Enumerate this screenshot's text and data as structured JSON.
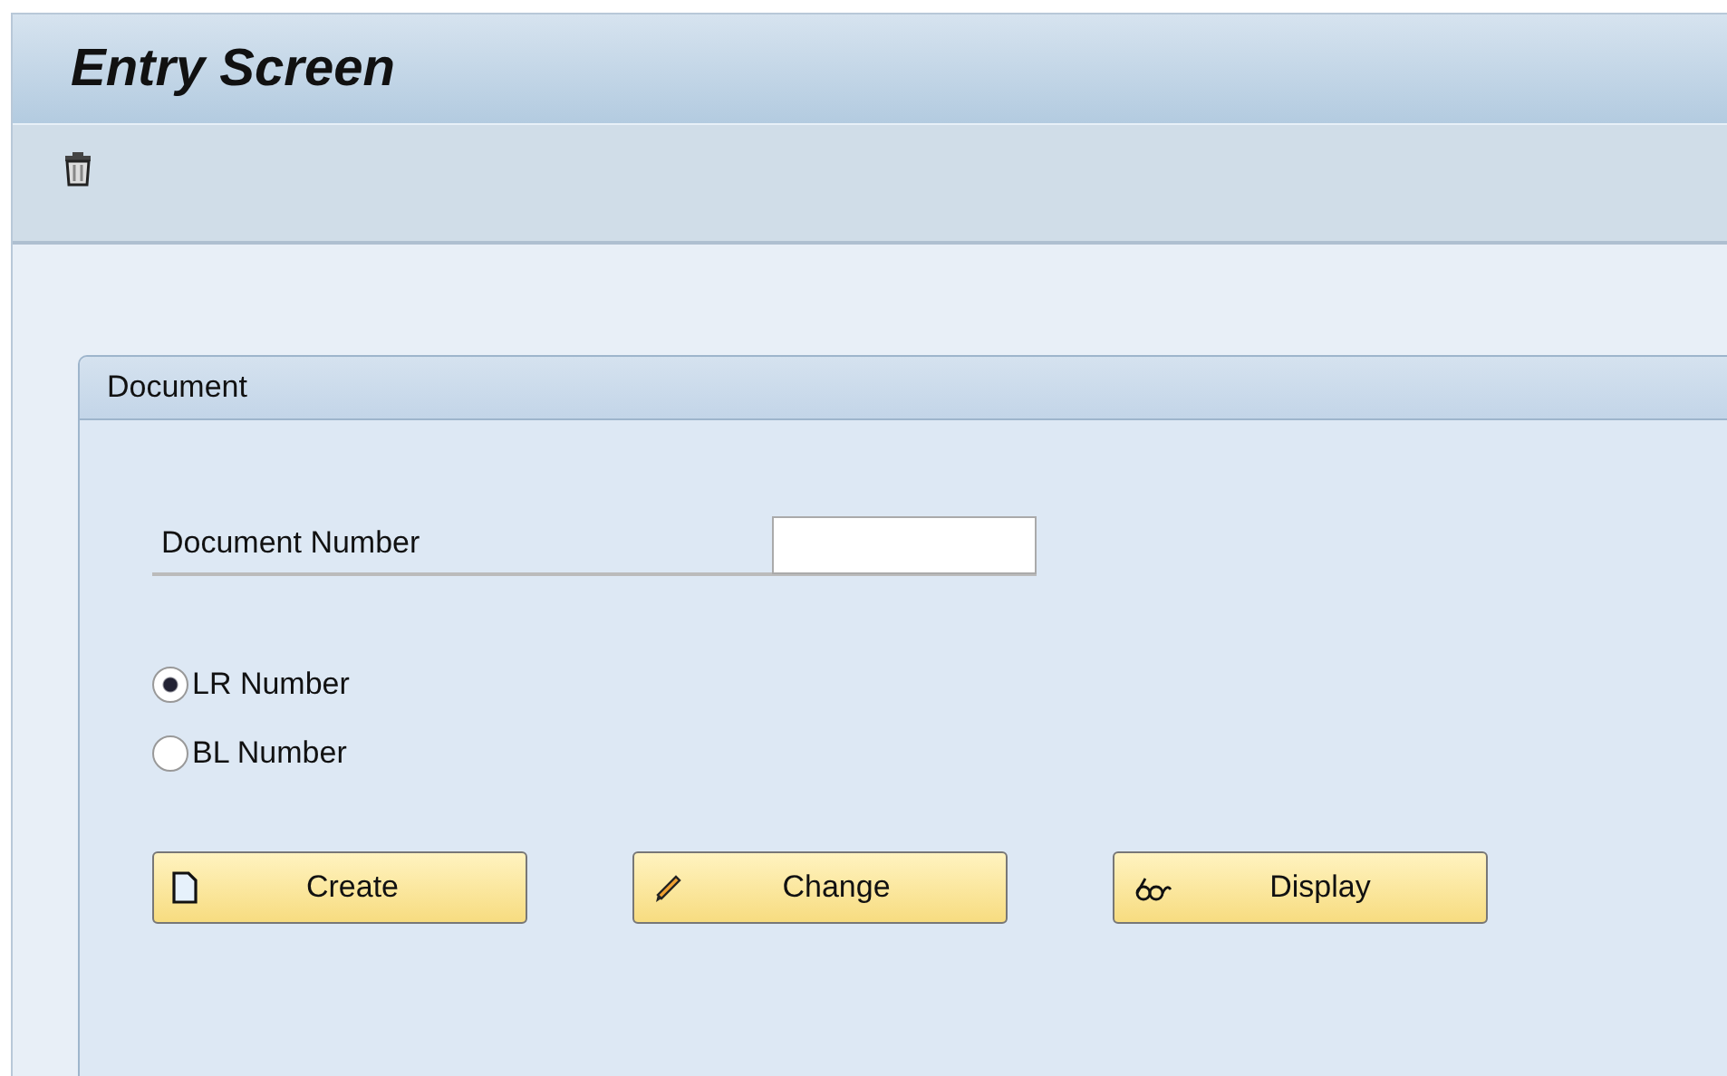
{
  "window": {
    "title": "Entry Screen"
  },
  "toolbar": [
    {
      "kind": "delete"
    }
  ],
  "group": {
    "title": "Document",
    "field": {
      "label": "Document Number"
    },
    "radios": [
      {
        "label": "LR Number",
        "selected": true
      },
      {
        "label": "BL Number",
        "selected": false
      }
    ],
    "buttons": [
      {
        "label": "Create",
        "kind": "create"
      },
      {
        "label": "Change",
        "kind": "change"
      },
      {
        "label": "Display",
        "kind": "display"
      }
    ]
  }
}
